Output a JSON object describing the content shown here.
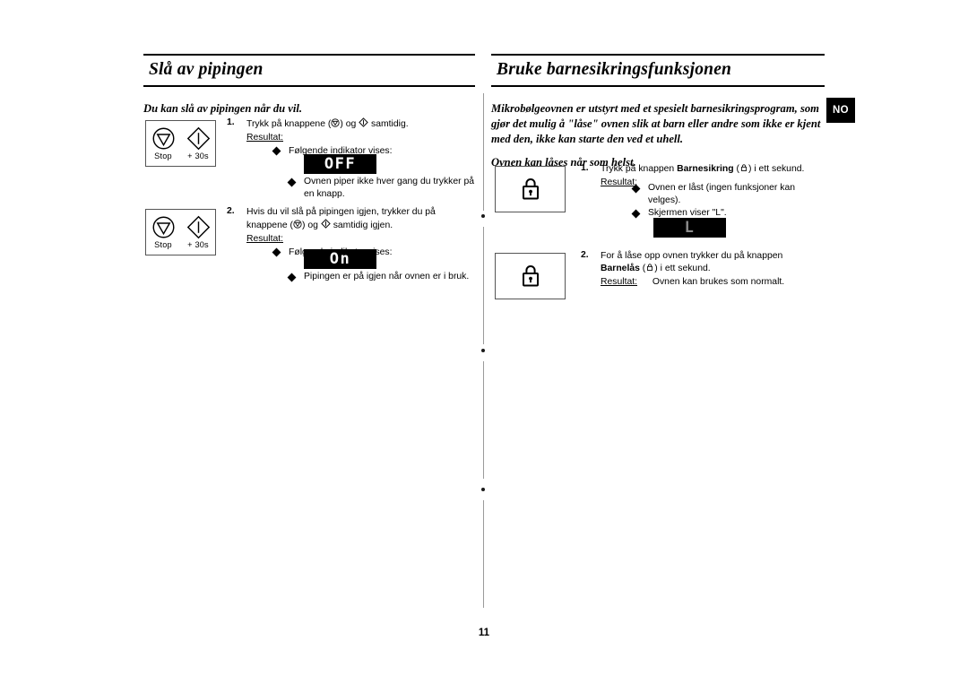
{
  "document": {
    "page_number": "11",
    "language_badge": "NO"
  },
  "left_column": {
    "heading": "Slå av pipingen",
    "lead": "Du kan slå av pipingen når du vil.",
    "steps": [
      {
        "number": "1.",
        "text_before_icon1": "Trykk på knappene (",
        "icon1": "stop-button-icon",
        "text_between": ") og",
        "icon2": "plus-30s-button-icon",
        "text_after": "samtidig.",
        "result_label": "Resultat:",
        "bullets": [
          {
            "text": "Følgende indikator vises:",
            "has_display": true
          },
          {
            "text": "Ovnen piper ikke hver gang du trykker på en knapp.",
            "has_display": false
          }
        ],
        "display_value": "OFF",
        "panel": {
          "keys": [
            {
              "icon": "stop-button-icon",
              "label": "Stop"
            },
            {
              "icon": "plus-30s-button-icon",
              "label": "+ 30s"
            }
          ]
        }
      },
      {
        "number": "2.",
        "line1": "Hvis du vil slå på pipingen igjen, trykker du på",
        "line2_before": "knappene (",
        "icon1": "stop-button-icon",
        "line2_between": ") og",
        "icon2": "plus-30s-button-icon",
        "line2_after": "samtidig igjen.",
        "result_label": "Resultat:",
        "bullets": [
          {
            "text": "Følgende indikator vises:",
            "has_display": true
          },
          {
            "text": "Pipingen er på igjen når ovnen er i bruk.",
            "has_display": false
          }
        ],
        "display_value": "On",
        "panel": {
          "keys": [
            {
              "icon": "stop-button-icon",
              "label": "Stop"
            },
            {
              "icon": "plus-30s-button-icon",
              "label": "+ 30s"
            }
          ]
        }
      }
    ]
  },
  "right_column": {
    "heading": "Bruke barnesikringsfunksjonen",
    "intro_paragraph": "Mikrobølgeovnen er utstyrt med et spesielt barnesikringsprogram, som gjør det mulig å \"låse\" ovnen slik at barn eller andre som ikke er kjent med den, ikke kan starte den ved et uhell.",
    "lead": "Ovnen kan låses når som helst.",
    "steps": [
      {
        "number": "1.",
        "text_before_bold": "Trykk på knappen",
        "bold_word": "Barnesikring",
        "text_after_bold": "i ett sekund.",
        "icon": "child-lock-icon",
        "result_label": "Resultat:",
        "bullets": [
          {
            "text": "Ovnen er låst (ingen funksjoner kan velges)."
          },
          {
            "text": "Skjermen viser \"L\"."
          }
        ],
        "display_value": "L",
        "panel": {
          "icon": "padlock-icon"
        }
      },
      {
        "number": "2.",
        "line1": "For å låse opp ovnen trykker du på knappen",
        "bold_word": "Barnelås",
        "text_after_bold": "i ett sekund.",
        "icon": "child-lock-icon",
        "result_label": "Resultat:",
        "result_text": "Ovnen kan brukes som normalt.",
        "panel": {
          "icon": "padlock-icon"
        }
      }
    ]
  }
}
